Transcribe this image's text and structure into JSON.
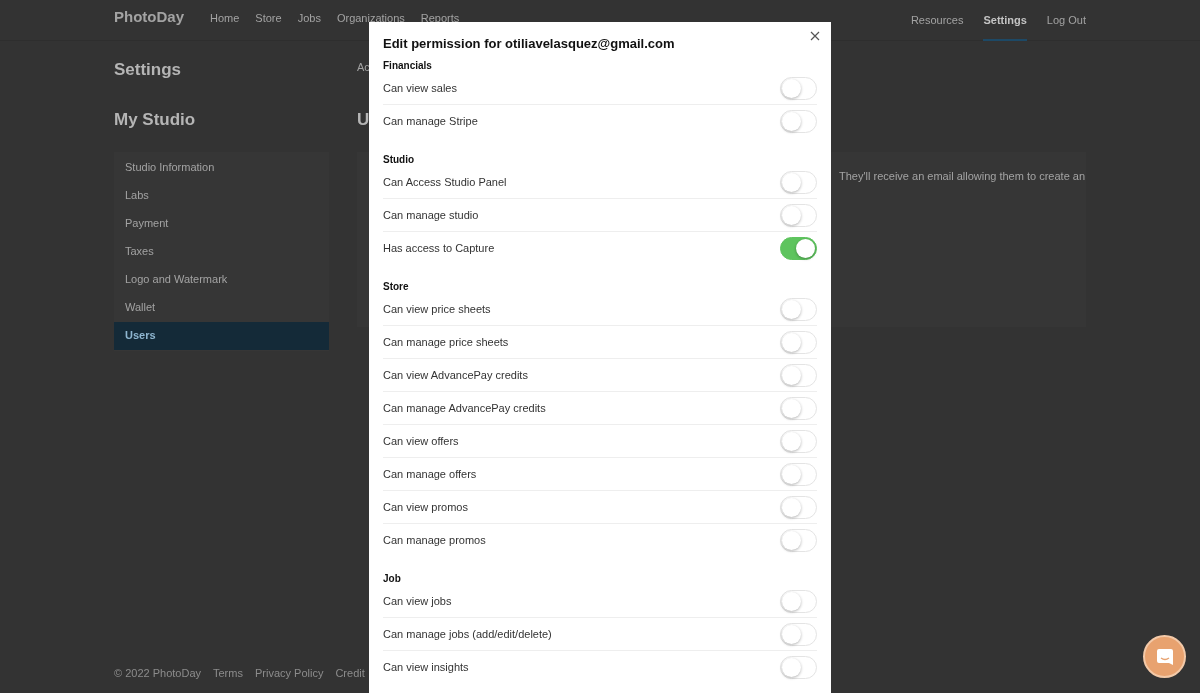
{
  "header": {
    "logo": "PhotoDay",
    "nav_left": [
      {
        "label": "Home",
        "selected": false
      },
      {
        "label": "Store",
        "selected": false
      },
      {
        "label": "Jobs",
        "selected": false
      },
      {
        "label": "Organizations",
        "selected": false
      },
      {
        "label": "Reports",
        "selected": false
      }
    ],
    "nav_right": [
      {
        "label": "Resources",
        "selected": false
      },
      {
        "label": "Settings",
        "selected": true
      },
      {
        "label": "Log Out",
        "selected": false
      }
    ]
  },
  "page": {
    "title": "Settings",
    "sidebar_title": "My Studio",
    "sidebar_items": [
      {
        "label": "Studio Information",
        "selected": false
      },
      {
        "label": "Labs",
        "selected": false
      },
      {
        "label": "Payment",
        "selected": false
      },
      {
        "label": "Taxes",
        "selected": false
      },
      {
        "label": "Logo and Watermark",
        "selected": false
      },
      {
        "label": "Wallet",
        "selected": false
      },
      {
        "label": "Users",
        "selected": true
      }
    ],
    "breadcrumb": "Ac",
    "section_title": "U",
    "card_text": "They'll receive an email allowing them to create an"
  },
  "footer": {
    "copyright": "© 2022 PhotoDay",
    "links": [
      "Terms",
      "Privacy Policy",
      "Credit"
    ]
  },
  "modal": {
    "title": "Edit permission for otiliavelasquez@gmail.com",
    "sections": [
      {
        "heading": "Financials",
        "permissions": [
          {
            "label": "Can view sales",
            "on": false
          },
          {
            "label": "Can manage Stripe",
            "on": false
          }
        ]
      },
      {
        "heading": "Studio",
        "permissions": [
          {
            "label": "Can Access Studio Panel",
            "on": false
          },
          {
            "label": "Can manage studio",
            "on": false
          },
          {
            "label": "Has access to Capture",
            "on": true
          }
        ]
      },
      {
        "heading": "Store",
        "permissions": [
          {
            "label": "Can view price sheets",
            "on": false
          },
          {
            "label": "Can manage price sheets",
            "on": false
          },
          {
            "label": "Can view AdvancePay credits",
            "on": false
          },
          {
            "label": "Can manage AdvancePay credits",
            "on": false
          },
          {
            "label": "Can view offers",
            "on": false
          },
          {
            "label": "Can manage offers",
            "on": false
          },
          {
            "label": "Can view promos",
            "on": false
          },
          {
            "label": "Can manage promos",
            "on": false
          }
        ]
      },
      {
        "heading": "Job",
        "permissions": [
          {
            "label": "Can view jobs",
            "on": false
          },
          {
            "label": "Can manage jobs (add/edit/delete)",
            "on": false
          },
          {
            "label": "Can view insights",
            "on": false
          }
        ]
      }
    ]
  }
}
